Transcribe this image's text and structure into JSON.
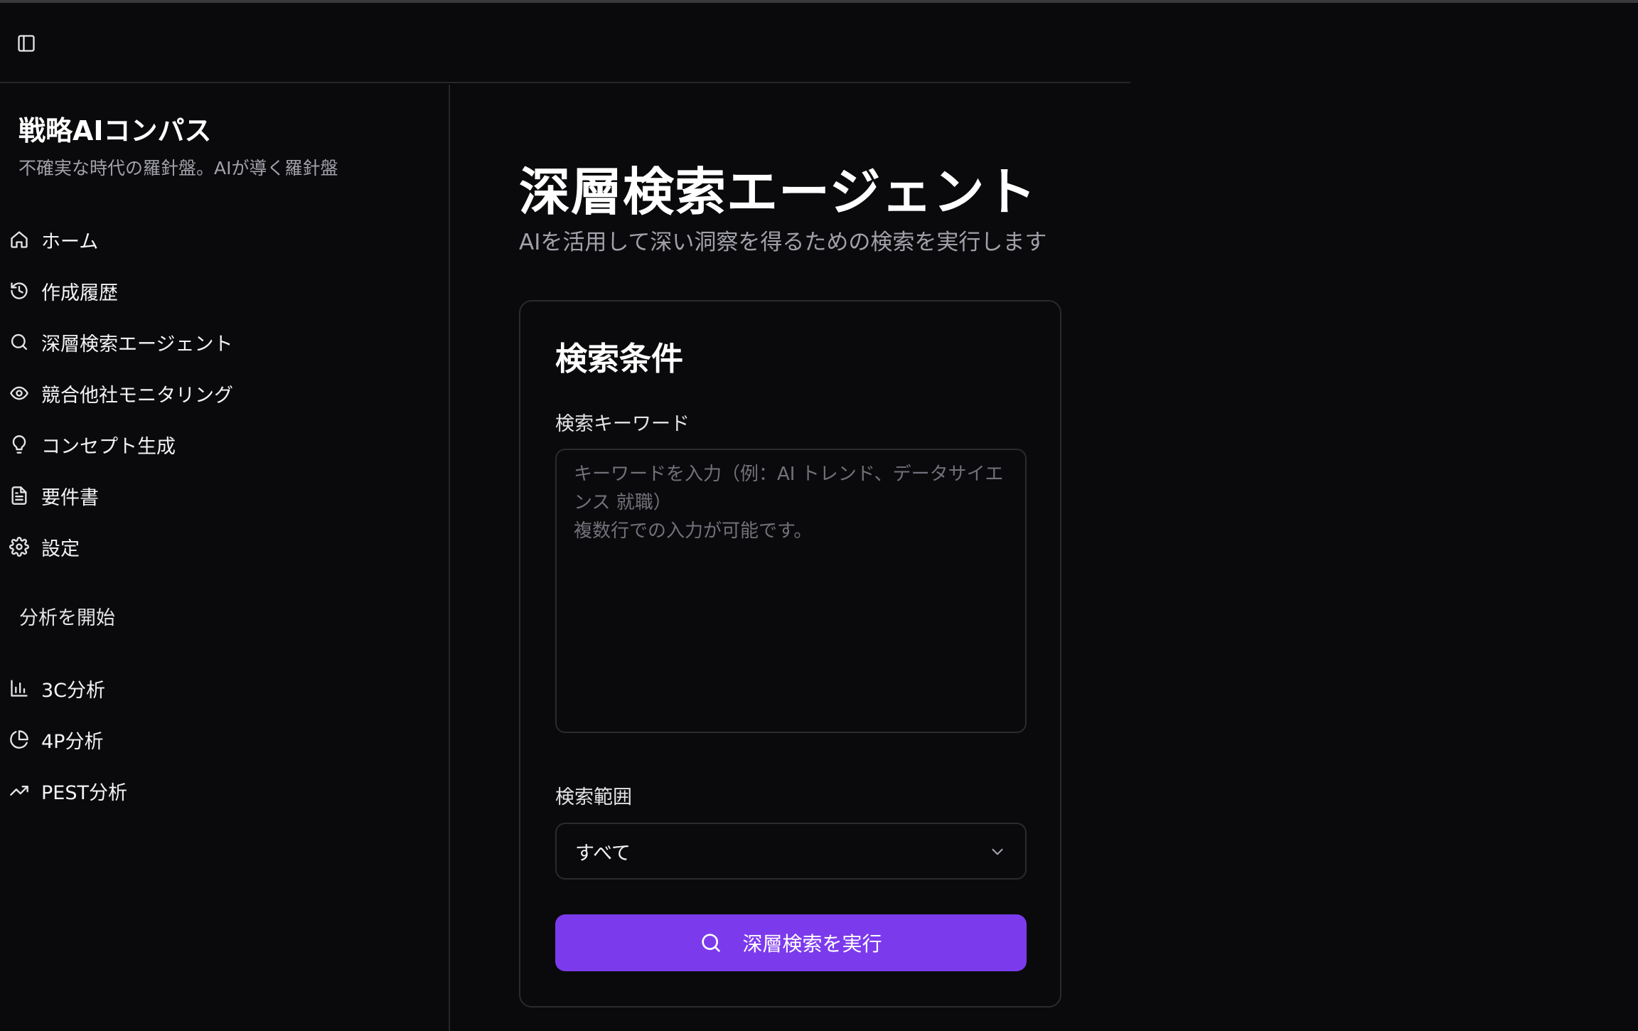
{
  "sidebar": {
    "brand_title": "戦略AIコンパス",
    "brand_subtitle": "不確実な時代の羅針盤。AIが導く羅針盤",
    "main_items": [
      {
        "label": "ホーム",
        "icon": "home-icon"
      },
      {
        "label": "作成履歴",
        "icon": "history-icon"
      },
      {
        "label": "深層検索エージェント",
        "icon": "search-icon"
      },
      {
        "label": "競合他社モニタリング",
        "icon": "eye-icon"
      },
      {
        "label": "コンセプト生成",
        "icon": "lightbulb-icon"
      },
      {
        "label": "要件書",
        "icon": "document-icon"
      },
      {
        "label": "設定",
        "icon": "gear-icon"
      }
    ],
    "section_label": "分析を開始",
    "analysis_items": [
      {
        "label": "3C分析",
        "icon": "bar-chart-icon"
      },
      {
        "label": "4P分析",
        "icon": "pie-chart-icon"
      },
      {
        "label": "PEST分析",
        "icon": "trending-up-icon"
      }
    ]
  },
  "main": {
    "title": "深層検索エージェント",
    "subtitle": "AIを活用して深い洞察を得るための検索を実行します",
    "card": {
      "title": "検索条件",
      "keyword_label": "検索キーワード",
      "keyword_placeholder": "キーワードを入力（例：AI トレンド、データサイエンス 就職）\n複数行での入力が可能です。",
      "keyword_value": "",
      "scope_label": "検索範囲",
      "scope_value": "すべて",
      "submit_label": "深層検索を実行"
    }
  },
  "colors": {
    "background": "#0a0a0c",
    "accent": "#7c3aed",
    "border": "#2a2a2f",
    "muted_text": "#a1a1aa"
  }
}
